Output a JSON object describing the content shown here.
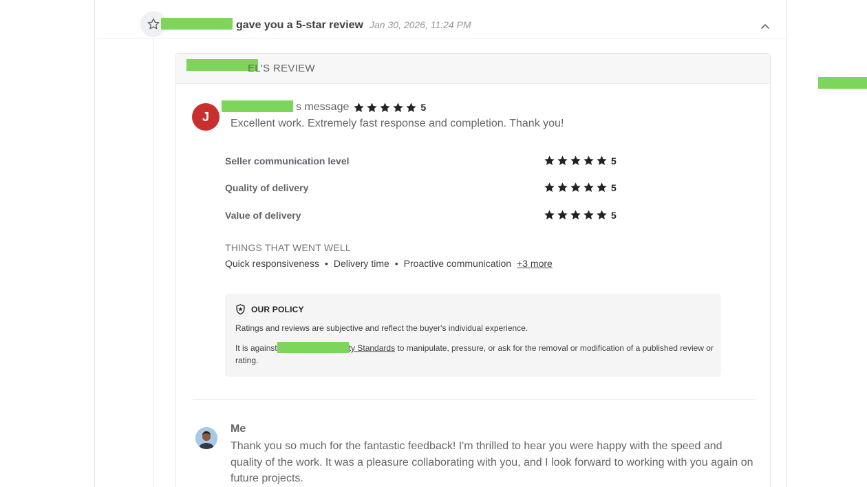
{
  "notification": {
    "title": "gave you a 5-star review",
    "date": "Jan 30, 2026, 11:24 PM",
    "icon": "star-outline-icon",
    "collapse_icon": "chevron-up-icon"
  },
  "review_card": {
    "header_title": "EL'S REVIEW",
    "buyer": {
      "avatar_letter": "J",
      "avatar_color": "#c8302d",
      "message_label": "s message",
      "rating": "5",
      "comment": "Excellent work. Extremely fast response and completion. Thank you!"
    },
    "ratings": [
      {
        "label": "Seller communication level",
        "value": "5",
        "stars": 5
      },
      {
        "label": "Quality of delivery",
        "value": "5",
        "stars": 5
      },
      {
        "label": "Value of delivery",
        "value": "5",
        "stars": 5
      }
    ],
    "went_well": {
      "title": "THINGS THAT WENT WELL",
      "items": [
        "Quick responsiveness",
        "Delivery time",
        "Proactive communication"
      ],
      "more_link": "+3 more"
    },
    "policy": {
      "title": "OUR POLICY",
      "line1": "Ratings and reviews are subjective and reflect the buyer's individual experience.",
      "line2_prefix": "It is against",
      "line2_link": "ty Standards",
      "line2_suffix": " to manipulate, pressure, or ask for the removal or modification of a published review or rating."
    },
    "reply": {
      "name": "Me",
      "text": "Thank you so much for the fantastic feedback! I'm thrilled to hear you were happy with the speed and quality of the work. It was a pleasure collaborating with you, and I look forward to working with you again on future projects."
    }
  },
  "colors": {
    "redaction": "#7dd65b",
    "star": "#222325",
    "text_primary": "#404145",
    "text_muted": "#62646a"
  }
}
